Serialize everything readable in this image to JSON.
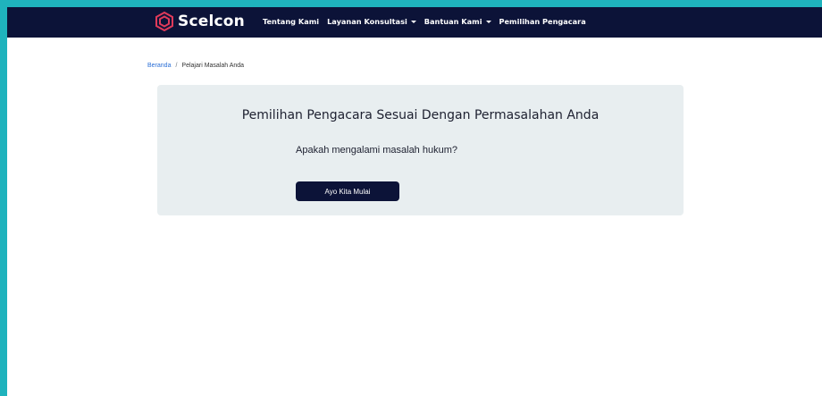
{
  "brand": {
    "name": "Scelcon",
    "logo_icon": "hexagon-logo-icon",
    "logo_color": "#e03a5a"
  },
  "nav": {
    "items": [
      {
        "label": "Tentang Kami",
        "has_dropdown": false
      },
      {
        "label": "Layanan Konsultasi",
        "has_dropdown": true
      },
      {
        "label": "Bantuan Kami",
        "has_dropdown": true
      },
      {
        "label": "Pemilihan Pengacara",
        "has_dropdown": false
      }
    ]
  },
  "breadcrumb": {
    "home": "Beranda",
    "separator": "/",
    "current": "Pelajari Masalah Anda"
  },
  "card": {
    "title": "Pemilihan Pengacara Sesuai Dengan Permasalahan Anda",
    "question": "Apakah mengalami masalah hukum?",
    "button_label": "Ayo Kita Mulai"
  },
  "colors": {
    "navbar": "#0c1338",
    "background": "#1fb3bd",
    "card": "#e8eef0",
    "link": "#2b6fd6"
  }
}
